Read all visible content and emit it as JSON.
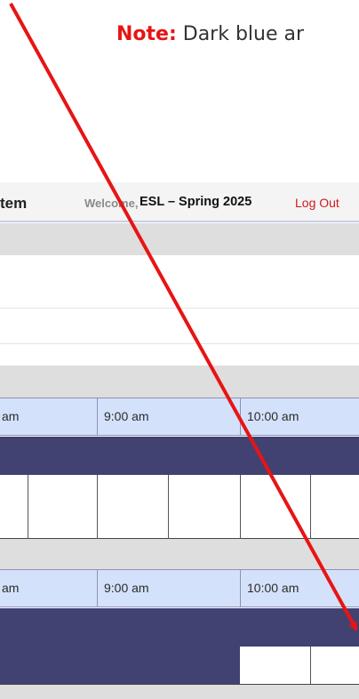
{
  "note": {
    "label": "Note:",
    "text": " Dark blue ar"
  },
  "header": {
    "title_fragment": "tem",
    "welcome": "Welcome,",
    "semester": "ESL – Spring 2025",
    "logout": "Log Out"
  },
  "schedule": {
    "section_1": {
      "times": [
        "am",
        "9:00 am",
        "10:00 am"
      ]
    },
    "section_2": {
      "times": [
        "am",
        "9:00 am",
        "10:00 am"
      ]
    }
  },
  "colors": {
    "note_label": "#e81414",
    "logout": "#d21a1a",
    "booked_block": "#414271",
    "time_header_bg": "#d4e1fb",
    "annotation_arrow": "#e81414"
  }
}
